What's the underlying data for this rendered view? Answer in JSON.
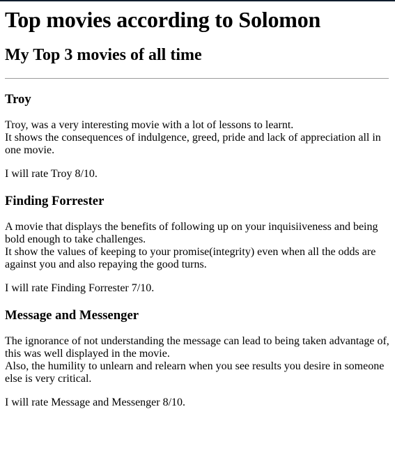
{
  "page": {
    "title": "Top movies according to Solomon",
    "subtitle": "My Top 3 movies of all time"
  },
  "movies": [
    {
      "name": "Troy",
      "description_lines": [
        "Troy, was a very interesting movie with a lot of lessons to learnt.",
        "It shows the consequences of indulgence, greed, pride and lack of appreciation all in one movie."
      ],
      "rating_text": "I will rate Troy 8/10."
    },
    {
      "name": "Finding Forrester",
      "description_lines": [
        "A movie that displays the benefits of following up on your inquisiiveness and being bold enough to take challenges.",
        "It show the values of keeping to your promise(integrity) even when all the odds are against you and also repaying the good turns."
      ],
      "rating_text": "I will rate Finding Forrester 7/10."
    },
    {
      "name": "Message and Messenger",
      "description_lines": [
        "The ignorance of not understanding the message can lead to being taken advantage of, this was well displayed in the movie.",
        "Also, the humility to unlearn and relearn when you see results you desire in someone else is very critical."
      ],
      "rating_text": "I will rate Message and Messenger 8/10."
    }
  ]
}
